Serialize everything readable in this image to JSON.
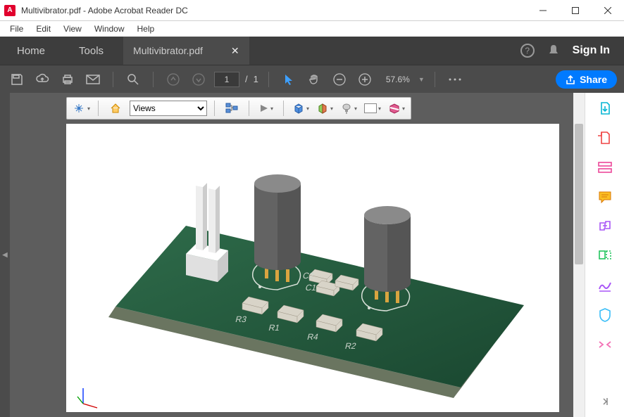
{
  "window": {
    "title": "Multivibrator.pdf - Adobe Acrobat Reader DC",
    "app_badge": "A"
  },
  "menubar": [
    "File",
    "Edit",
    "View",
    "Window",
    "Help"
  ],
  "tabbar": {
    "nav": [
      "Home",
      "Tools"
    ],
    "doc_tab": "Multivibrator.pdf",
    "signin": "Sign In"
  },
  "toolbar": {
    "page_current": "1",
    "page_sep": "/",
    "page_total": "1",
    "zoom": "57.6%",
    "share": "Share"
  },
  "pdf3d_toolbar": {
    "views_label": "Views"
  },
  "pcb": {
    "labels": [
      "C2",
      "C1",
      "R3",
      "R1",
      "R4",
      "R2"
    ]
  },
  "colors": {
    "accent": "#007aff",
    "app_red": "#e1002d",
    "chrome_dark": "#4b4b4b"
  }
}
